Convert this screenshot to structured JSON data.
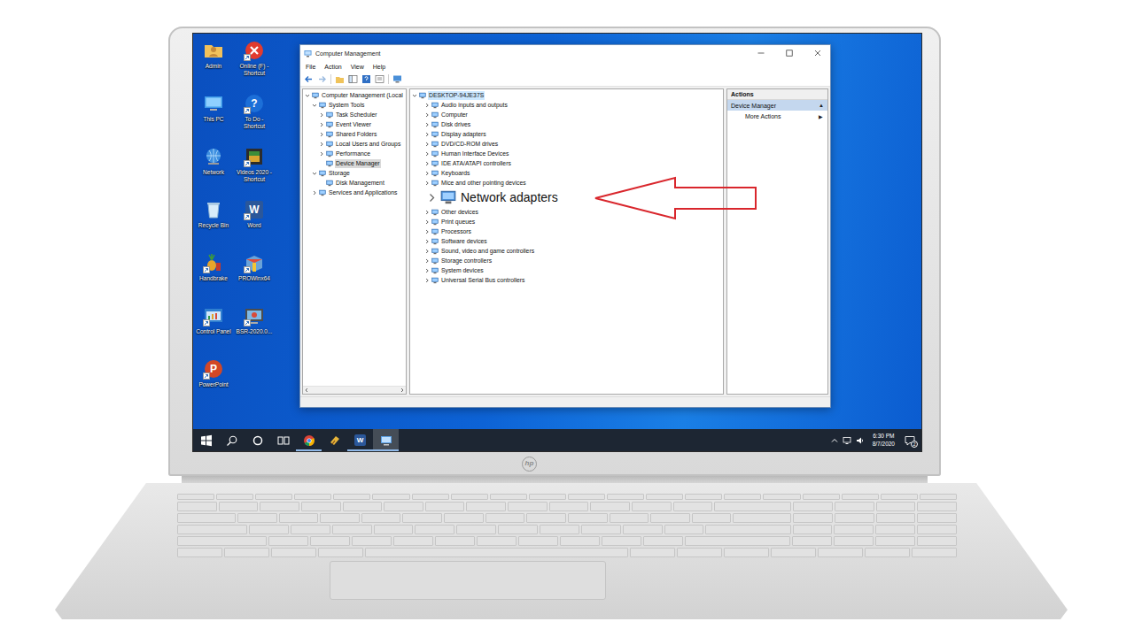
{
  "desktop": {
    "icons": [
      {
        "label": "Admin",
        "kind": "user-folder",
        "shortcut": false
      },
      {
        "label": "Online (F) - Shortcut",
        "kind": "error",
        "shortcut": true
      },
      {
        "label": "This PC",
        "kind": "pc",
        "shortcut": false
      },
      {
        "label": "To Do - Shortcut",
        "kind": "help",
        "glyph": "?",
        "shortcut": true
      },
      {
        "label": "Network",
        "kind": "network",
        "shortcut": false
      },
      {
        "label": "Videos 2020 - Shortcut",
        "kind": "video",
        "shortcut": true
      },
      {
        "label": "Recycle Bin",
        "kind": "recycle",
        "shortcut": false
      },
      {
        "label": "Word",
        "kind": "word",
        "glyph": "W",
        "shortcut": true
      },
      {
        "label": "Handbrake",
        "kind": "handbrake",
        "shortcut": true
      },
      {
        "label": "PROWinx64",
        "kind": "package",
        "shortcut": true
      },
      {
        "label": "Control Panel",
        "kind": "control-panel",
        "shortcut": true
      },
      {
        "label": "BSR-2020.0...",
        "kind": "recorder",
        "shortcut": true
      },
      {
        "label": "PowerPoint",
        "kind": "powerpoint",
        "glyph": "P",
        "shortcut": true
      }
    ]
  },
  "window": {
    "title": "Computer Management",
    "menu": [
      "File",
      "Action",
      "View",
      "Help"
    ],
    "navigation": [
      {
        "label": "Computer Management (Local",
        "expandable": true,
        "expanded": true,
        "selected": false,
        "children": [
          {
            "label": "System Tools",
            "expandable": true,
            "expanded": true,
            "selected": false,
            "children": [
              {
                "label": "Task Scheduler",
                "expandable": true,
                "expanded": false,
                "selected": false
              },
              {
                "label": "Event Viewer",
                "expandable": true,
                "expanded": false,
                "selected": false
              },
              {
                "label": "Shared Folders",
                "expandable": true,
                "expanded": false,
                "selected": false
              },
              {
                "label": "Local Users and Groups",
                "expandable": true,
                "expanded": false,
                "selected": false
              },
              {
                "label": "Performance",
                "expandable": true,
                "expanded": false,
                "selected": false
              },
              {
                "label": "Device Manager",
                "expandable": false,
                "expanded": false,
                "selected": true
              }
            ]
          },
          {
            "label": "Storage",
            "expandable": true,
            "expanded": true,
            "selected": false,
            "children": [
              {
                "label": "Disk Management",
                "expandable": false,
                "expanded": false,
                "selected": false
              }
            ]
          },
          {
            "label": "Services and Applications",
            "expandable": true,
            "expanded": false,
            "selected": false
          }
        ]
      }
    ],
    "devices": {
      "root": {
        "label": "DESKTOP-94JE37S",
        "expanded": true,
        "selected": true
      },
      "categories": [
        {
          "label": "Audio inputs and outputs",
          "kind": "category",
          "expanded": false
        },
        {
          "label": "Computer",
          "kind": "category",
          "expanded": false
        },
        {
          "label": "Disk drives",
          "kind": "category",
          "expanded": false
        },
        {
          "label": "Display adapters",
          "kind": "category",
          "expanded": false
        },
        {
          "label": "DVD/CD-ROM drives",
          "kind": "category",
          "expanded": false
        },
        {
          "label": "Human Interface Devices",
          "kind": "category",
          "expanded": false
        },
        {
          "label": "IDE ATA/ATAPI controllers",
          "kind": "category",
          "expanded": false
        },
        {
          "label": "Keyboards",
          "kind": "category",
          "expanded": false
        },
        {
          "label": "Mice and other pointing devices",
          "kind": "category",
          "expanded": false
        },
        {
          "label": "Network adapters",
          "kind": "callout",
          "expanded": false
        },
        {
          "label": "Other devices",
          "kind": "category",
          "expanded": false
        },
        {
          "label": "Print queues",
          "kind": "category",
          "expanded": false
        },
        {
          "label": "Processors",
          "kind": "category",
          "expanded": false
        },
        {
          "label": "Software devices",
          "kind": "category",
          "expanded": false
        },
        {
          "label": "Sound, video and game controllers",
          "kind": "category",
          "expanded": false
        },
        {
          "label": "Storage controllers",
          "kind": "category",
          "expanded": false
        },
        {
          "label": "System devices",
          "kind": "category",
          "expanded": false
        },
        {
          "label": "Universal Serial Bus controllers",
          "kind": "category",
          "expanded": false
        }
      ]
    },
    "actions": {
      "title": "Actions",
      "section": {
        "label": "Device Manager",
        "glyph": "▲"
      },
      "items": [
        {
          "label": "More Actions",
          "glyph": "▶"
        }
      ]
    }
  },
  "taskbar": {
    "items": [
      {
        "kind": "start",
        "running": false,
        "selected": false
      },
      {
        "kind": "search",
        "running": false,
        "selected": false
      },
      {
        "kind": "cortana",
        "running": false,
        "selected": false
      },
      {
        "kind": "task-view",
        "running": false,
        "selected": false
      },
      {
        "kind": "chrome",
        "running": true,
        "selected": false
      },
      {
        "kind": "app",
        "running": false,
        "selected": false
      },
      {
        "kind": "word",
        "glyph": "W",
        "running": true,
        "selected": false
      },
      {
        "kind": "computer-management",
        "running": true,
        "selected": true
      }
    ],
    "tray": {
      "time": "6:30 PM",
      "date": "8/7/2020",
      "notifications": "2"
    }
  },
  "laptop": {
    "brand": "hp"
  }
}
